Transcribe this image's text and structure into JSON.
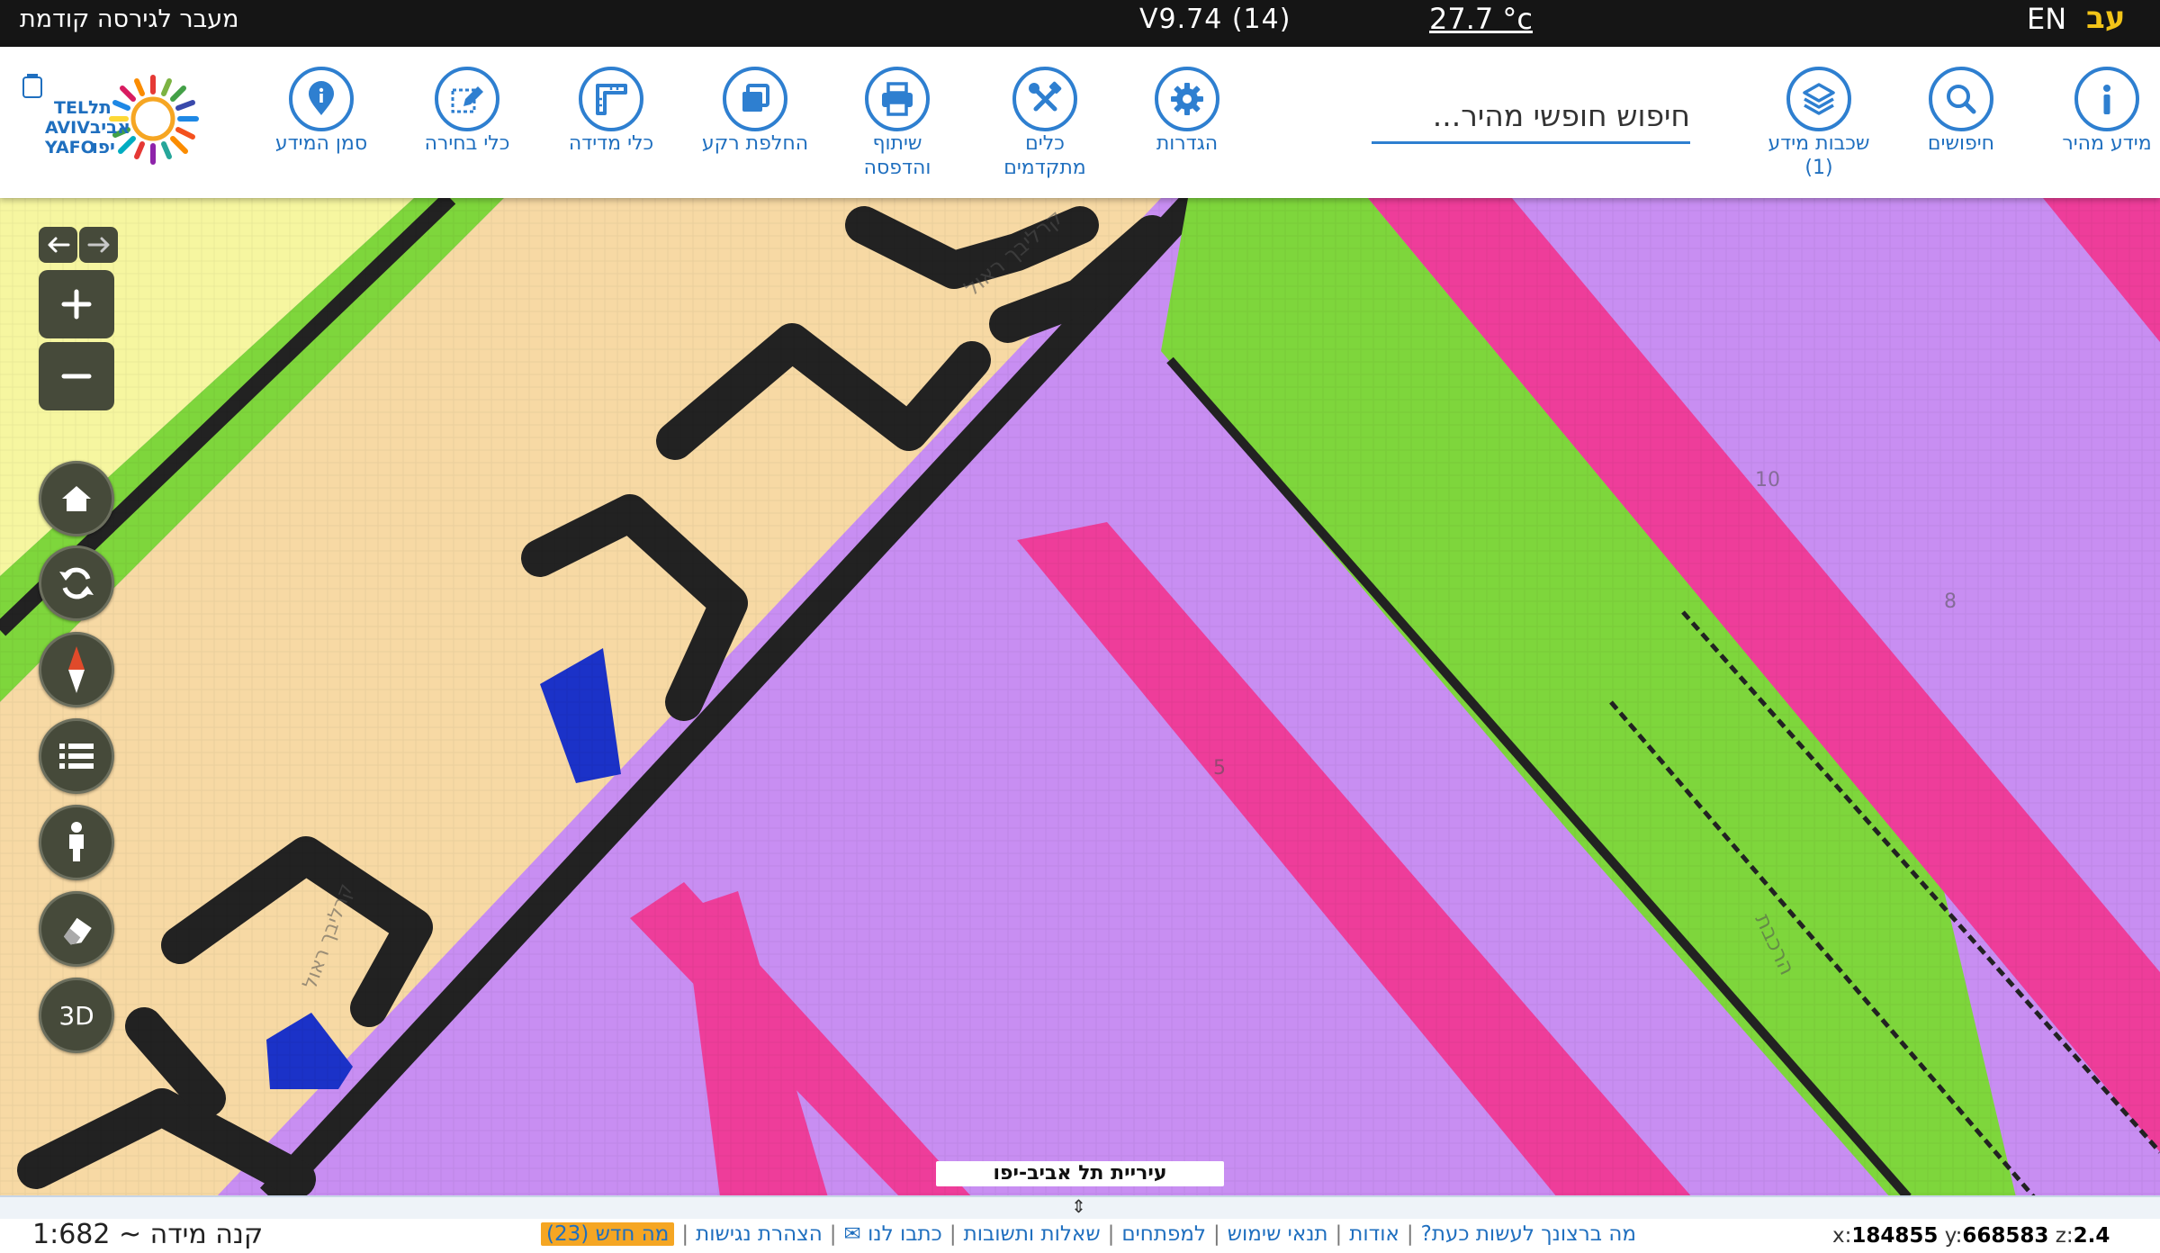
{
  "topbar": {
    "prev_version": "מעבר לגירסה קודמת",
    "version": "V9.74 (14)",
    "temperature": "27.7 °c",
    "lang_en": "EN",
    "lang_he": "עב"
  },
  "toolbar": {
    "quick_info": "מידע מהיר",
    "searches": "חיפושים",
    "layers_line1": "שכבות מידע",
    "layers_line2": "(1)",
    "search_placeholder": "חיפוש חופשי מהיר...",
    "settings": "הגדרות",
    "advanced_tools_line1": "כלים",
    "advanced_tools_line2": "מתקדמים",
    "share_print_line1": "שיתוף",
    "share_print_line2": "והדפסה",
    "switch_basemap": "החלפת רקע",
    "measure_tools": "כלי מדידה",
    "selection_tools": "כלי בחירה",
    "info_marker": "סמן המידע",
    "logo_text_he_line1": "תל",
    "logo_text_he_line2": "אביב",
    "logo_text_he_line3": "יפו",
    "logo_text_en_line1": "TEL",
    "logo_text_en_line2": "AVIV",
    "logo_text_en_line3": "YAFO"
  },
  "map": {
    "bottom_label": "עיריית תל אביב-יפו",
    "street_label_1": "קרליבך ראול",
    "street_label_2": "קרליבך ראול",
    "street_label_3": "הרכבת",
    "parcel_numbers": [
      "10",
      "8",
      "5"
    ],
    "controls": {
      "back": "←",
      "forward": "→",
      "zoom_in": "+",
      "zoom_out": "−",
      "three_d": "3D"
    },
    "colors": {
      "purple": "#c88ef2",
      "green": "#7ed63c",
      "pink": "#ee3d9a",
      "beige": "#f7d9a4",
      "yellow": "#f6f6a0",
      "dark": "#222222",
      "blue": "#1b32c8"
    }
  },
  "footer": {
    "scale": "קנה מידה ~ 1:682",
    "links": [
      "מה ברצונך לעשות כעת?",
      "אודות",
      "תנאי שימוש",
      "למפתחים",
      "שאלות ותשובות",
      "כתבו לנו ✉",
      "הצהרת נגישות"
    ],
    "whats_new": "מה חדש (23)",
    "coord_x_label": "x:",
    "coord_x": "184855",
    "coord_y_label": "y:",
    "coord_y": "668583",
    "coord_z_label": "z:",
    "coord_z": "2.4"
  },
  "icons": [
    "info-icon",
    "search-icon",
    "layers-icon",
    "gear-icon",
    "tools-icon",
    "printer-icon",
    "copy-icon",
    "ruler-icon",
    "pencil-select-icon",
    "location-pin-icon",
    "home-icon",
    "refresh-icon",
    "compass-icon",
    "list-icon",
    "street-view-person-icon",
    "eraser-icon",
    "arrow-left-icon",
    "arrow-right-icon"
  ]
}
